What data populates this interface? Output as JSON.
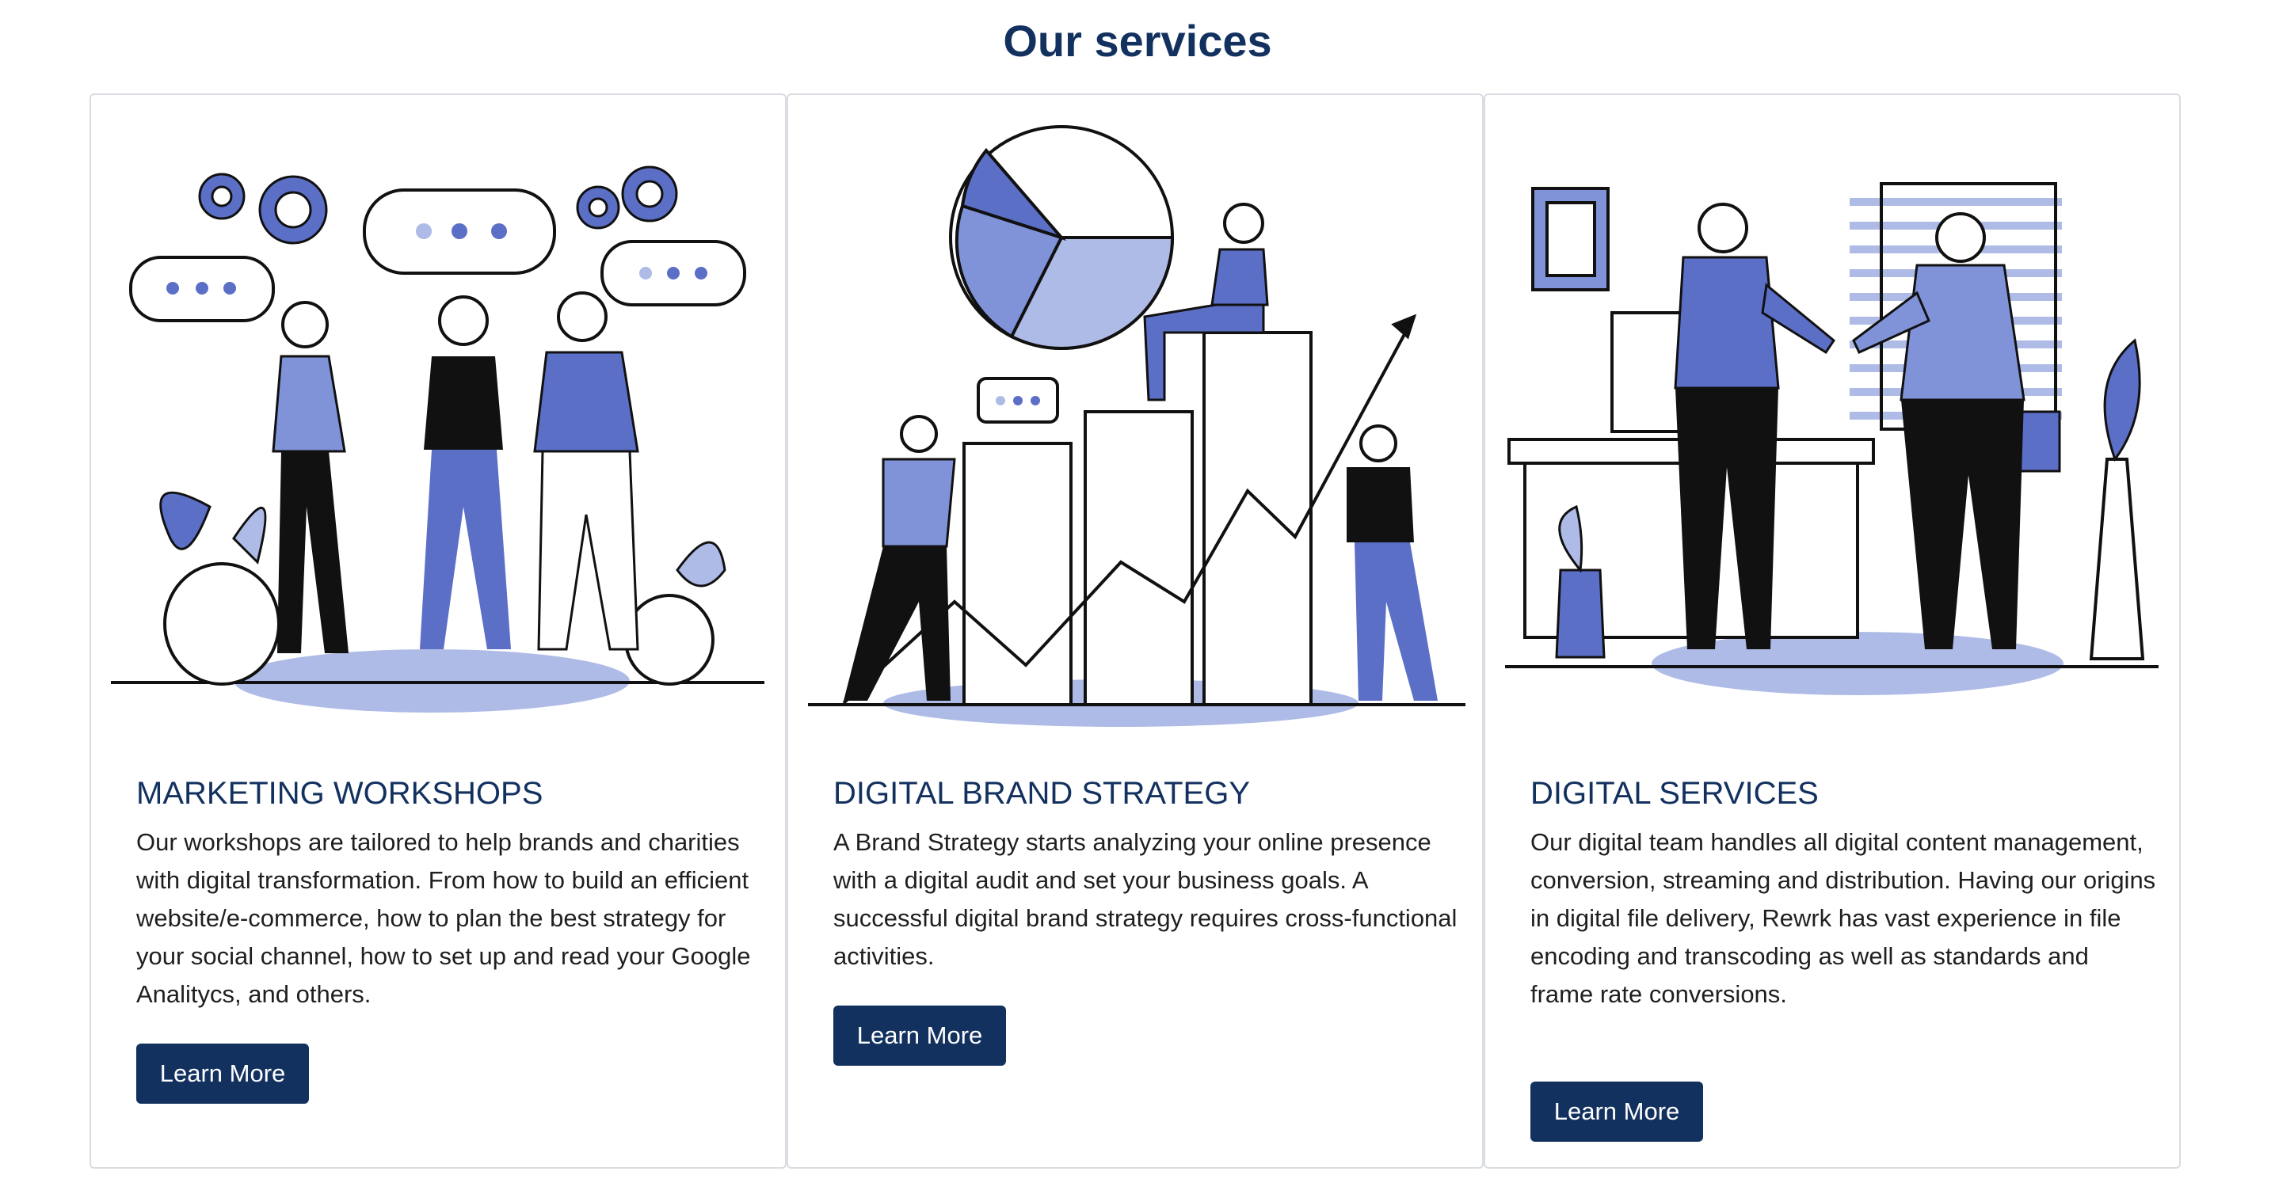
{
  "page": {
    "title": "Our services"
  },
  "colors": {
    "heading": "#13315f",
    "button_bg": "#13315f",
    "accent": "#5b6fc7",
    "border": "#d9dce1"
  },
  "cards": [
    {
      "illustration": "marketing-workshop-illustration",
      "heading": "MARKETING WORKSHOPS",
      "body": "Our workshops are tailored to help brands and charities with digital transformation. From how to build an efficient website/e-commerce, how to plan the best strategy for your social channel, how to set up and read your Google Analitycs, and others.",
      "button": "Learn More"
    },
    {
      "illustration": "brand-strategy-chart-illustration",
      "heading": "DIGITAL BRAND STRATEGY",
      "body": "A Brand Strategy starts analyzing your online presence with a digital audit and set your business goals. A successful digital brand strategy requires cross-functional activities.",
      "button": "Learn More"
    },
    {
      "illustration": "handshake-office-illustration",
      "heading": "DIGITAL SERVICES",
      "body": "Our digital team handles all digital content management, conversion, streaming and distribution. Having our origins in digital file delivery, Rewrk has vast experience in file encoding and transcoding as well as standards and frame rate conversions.",
      "button": "Learn More"
    }
  ]
}
